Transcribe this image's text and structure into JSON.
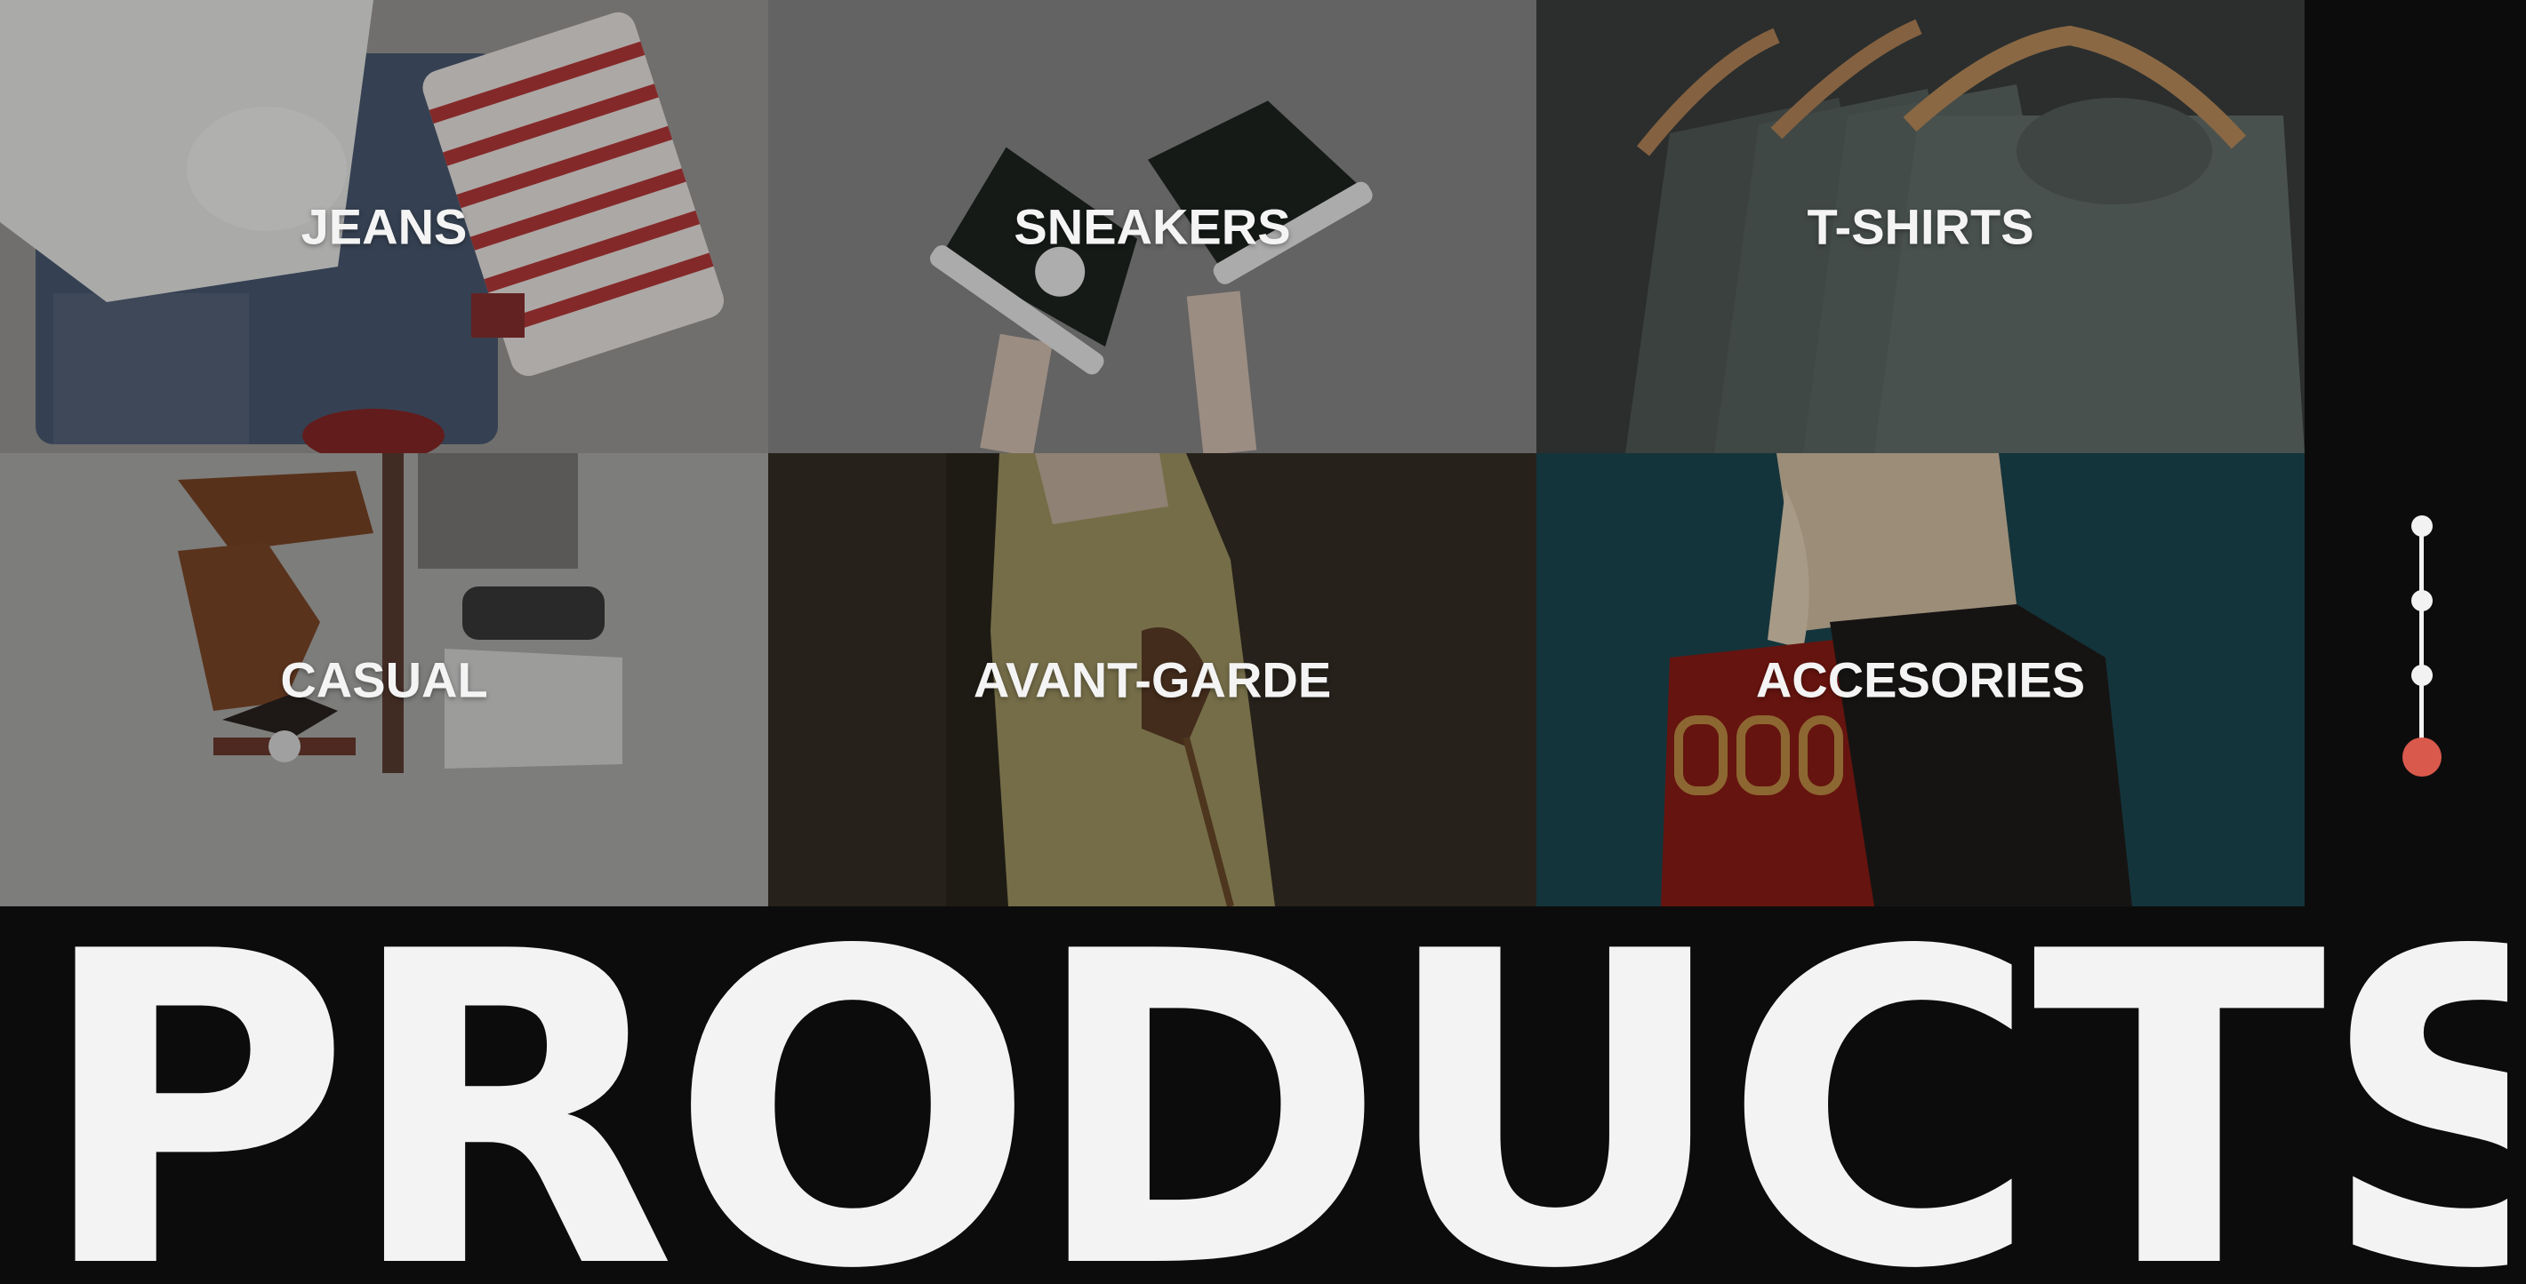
{
  "categories": [
    {
      "label": "JEANS",
      "bg": "#8d8d8b"
    },
    {
      "label": "SNEAKERS",
      "bg": "#7e7e7e"
    },
    {
      "label": "T-SHIRTS",
      "bg": "#454948"
    },
    {
      "label": "CASUAL",
      "bg": "#a4a4a2"
    },
    {
      "label": "AVANT-GARDE",
      "bg": "#3f3a2c"
    },
    {
      "label": "ACCESORIES",
      "bg": "#1d4a55"
    }
  ],
  "heading": "PRODUCTS",
  "colors": {
    "background": "#0c0c0c",
    "accent": "#d9594c",
    "text": "#f3f3f3"
  }
}
